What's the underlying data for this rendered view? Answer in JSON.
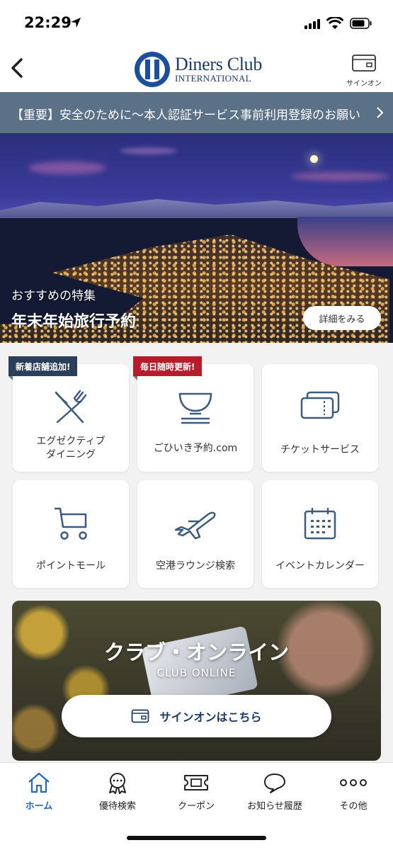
{
  "status": {
    "time": "22:29"
  },
  "header": {
    "logo_main": "Diners Club",
    "logo_sub": "INTERNATIONAL",
    "signon_label": "サインオン"
  },
  "notice": {
    "text": "【重要】安全のために〜本人認証サービス事前利用登録のお願い"
  },
  "hero": {
    "subtitle": "おすすめの特集",
    "title": "年末年始旅行予約",
    "button": "詳細をみる"
  },
  "services": {
    "badges": {
      "new_store": "新着店舗追加!",
      "daily_update": "毎日随時更新!"
    },
    "tiles": [
      {
        "line1": "エグゼクティブ",
        "line2": "ダイニング",
        "icon": "dining-icon"
      },
      {
        "label": "ごひいき予約.com",
        "icon": "bowl-icon"
      },
      {
        "label": "チケットサービス",
        "icon": "ticket-icon"
      },
      {
        "label": "ポイントモール",
        "icon": "cart-icon"
      },
      {
        "label": "空港ラウンジ検索",
        "icon": "airplane-icon"
      },
      {
        "label": "イベントカレンダー",
        "icon": "calendar-icon"
      }
    ]
  },
  "club": {
    "title": "クラブ・オンライン",
    "subtitle": "CLUB ONLINE",
    "button": "サインオンはこちら"
  },
  "tabbar": {
    "items": [
      {
        "label": "ホーム",
        "icon": "home-icon",
        "active": true
      },
      {
        "label": "優待検索",
        "icon": "badge-icon"
      },
      {
        "label": "クーポン",
        "icon": "coupon-icon"
      },
      {
        "label": "お知らせ履歴",
        "icon": "speech-bubble-icon"
      },
      {
        "label": "その他",
        "icon": "more-icon"
      }
    ]
  },
  "colors": {
    "brand": "#1b3a6a",
    "notice_bg": "#5b7187",
    "accent": "#1e6bc4",
    "badge_red": "#b71c2b",
    "badge_navy": "#2c3f5a"
  }
}
